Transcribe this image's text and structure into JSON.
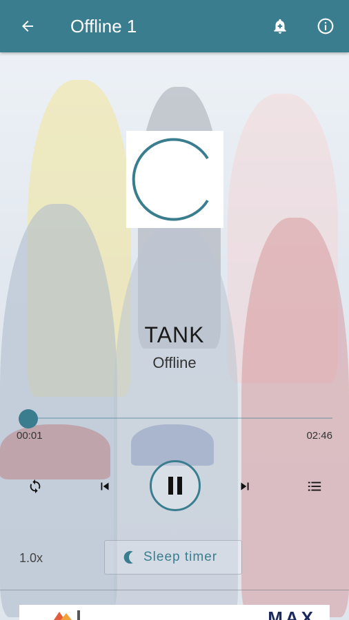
{
  "app": {
    "title": "Offline 1"
  },
  "header": {
    "back_icon": "arrow-back-icon",
    "alarm_icon": "bell-alarm-icon",
    "info_icon": "info-icon",
    "color": "#3a7d8f"
  },
  "player": {
    "track_title": "TANK",
    "track_subtitle": "Offline",
    "current_time": "00:01",
    "total_time": "02:46",
    "progress": 0.006,
    "speed": "1.0x",
    "sleep_timer_label": "Sleep timer",
    "loading": true
  },
  "controls": {
    "repeat_icon": "repeat-icon",
    "previous_icon": "skip-previous-icon",
    "pause_icon": "pause-icon",
    "next_icon": "skip-next-icon",
    "playlist_icon": "playlist-icon",
    "sleep_icon": "moon-icon"
  },
  "ad": {
    "text": "MAX"
  },
  "colors": {
    "accent": "#3a7d8f",
    "text": "#1a1a1a"
  }
}
